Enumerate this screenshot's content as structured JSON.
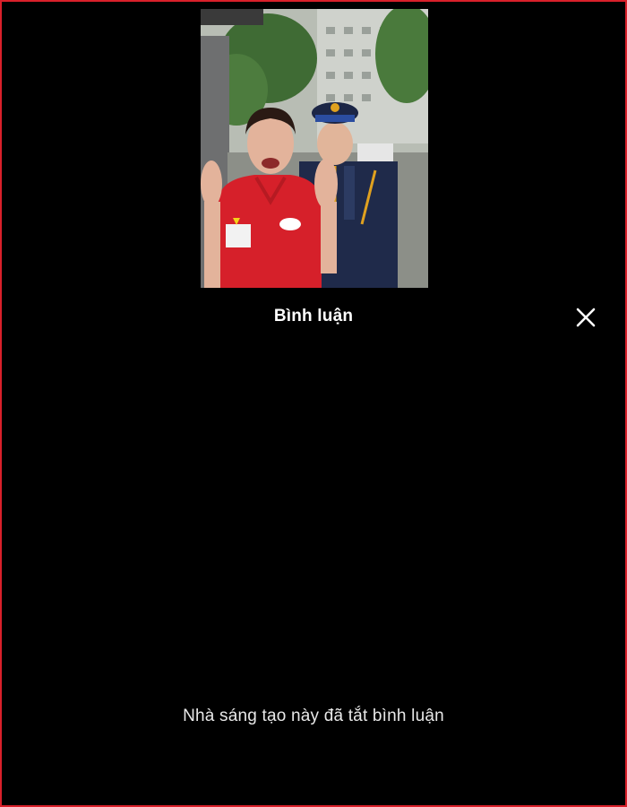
{
  "comments_sheet": {
    "title": "Bình luận",
    "close_icon": "close-icon",
    "empty_message": "Nhà sáng tạo này đã tắt bình luận"
  },
  "video": {
    "description": ""
  },
  "colors": {
    "background": "#000000",
    "frame_border": "#d9202a",
    "text": "#ffffff"
  }
}
